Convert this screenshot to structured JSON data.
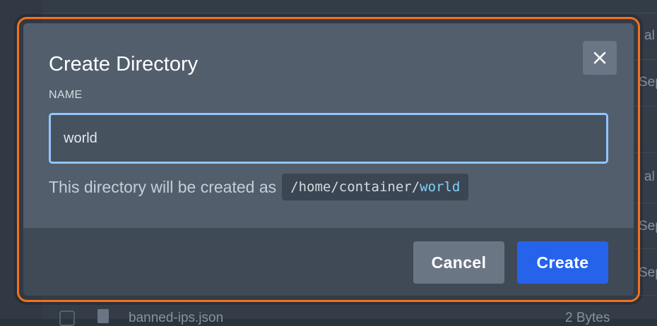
{
  "background": {
    "right_edge_fragments": [
      "al",
      "Sep",
      "al",
      "Sep",
      "Sep"
    ],
    "bottom_row": {
      "filename": "banned-ips.json",
      "size": "2 Bytes"
    }
  },
  "modal": {
    "title": "Create Directory",
    "close_icon": "close-icon",
    "field_label": "NAME",
    "input_value": "world",
    "helper_text": "This directory will be created as",
    "path_prefix": "/home/container/",
    "path_name": "world",
    "cancel_label": "Cancel",
    "create_label": "Create"
  },
  "colors": {
    "outline": "#f2711c",
    "create_button": "#2563eb",
    "input_focus_border": "#93c5fd",
    "path_highlight": "#7dd3fc"
  }
}
